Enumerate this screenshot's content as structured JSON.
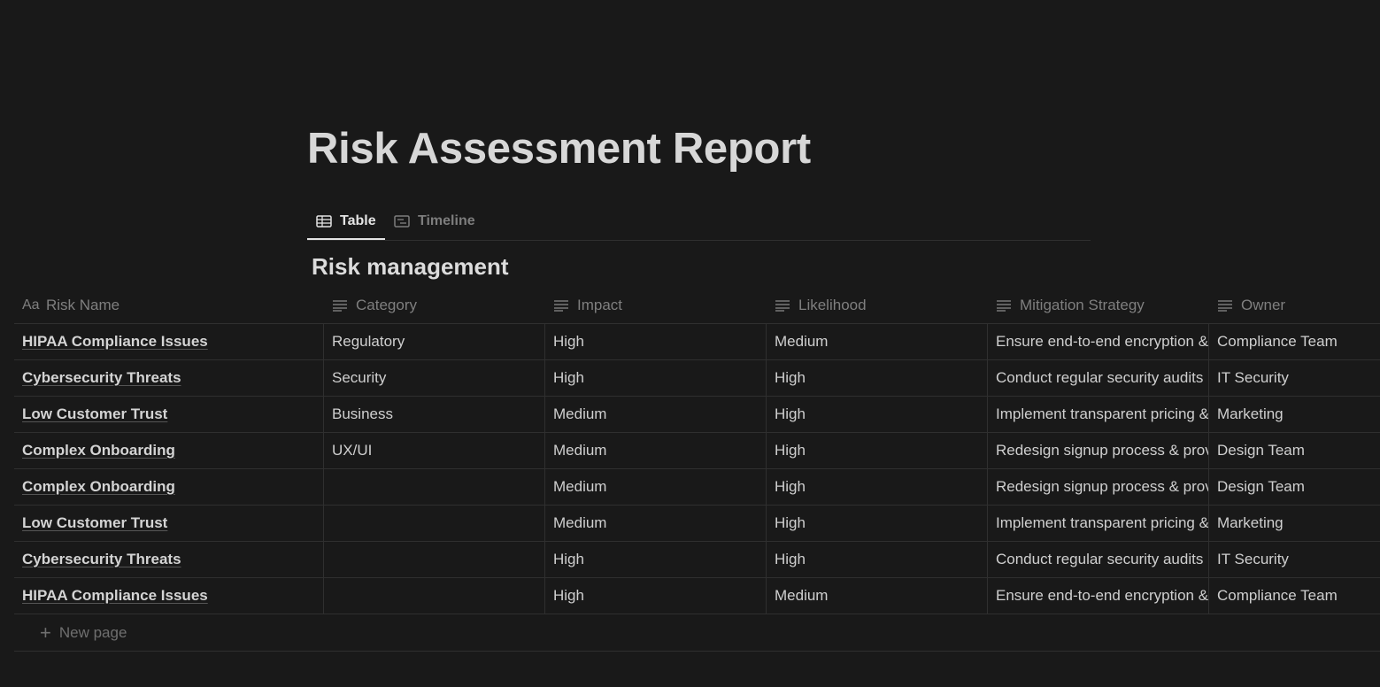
{
  "page": {
    "title": "Risk Assessment Report"
  },
  "tabs": [
    {
      "label": "Table",
      "icon": "table-icon",
      "active": true
    },
    {
      "label": "Timeline",
      "icon": "timeline-icon",
      "active": false
    }
  ],
  "database": {
    "title": "Risk management",
    "columns": [
      {
        "label": "Risk Name",
        "icon": "title-property-icon"
      },
      {
        "label": "Category",
        "icon": "text-property-icon"
      },
      {
        "label": "Impact",
        "icon": "text-property-icon"
      },
      {
        "label": "Likelihood",
        "icon": "text-property-icon"
      },
      {
        "label": "Mitigation Strategy",
        "icon": "text-property-icon"
      },
      {
        "label": "Owner",
        "icon": "text-property-icon"
      }
    ],
    "rows": [
      [
        "HIPAA Compliance Issues",
        "Regulatory",
        "High",
        "Medium",
        "Ensure end-to-end encryption &",
        "Compliance Team"
      ],
      [
        "Cybersecurity Threats",
        "Security",
        "High",
        "High",
        "Conduct regular security audits",
        "IT Security"
      ],
      [
        "Low Customer Trust",
        "Business",
        "Medium",
        "High",
        "Implement transparent pricing &",
        "Marketing"
      ],
      [
        "Complex Onboarding",
        "UX/UI",
        "Medium",
        "High",
        "Redesign signup process & prov",
        "Design Team"
      ],
      [
        "Complex Onboarding",
        "",
        "Medium",
        "High",
        "Redesign signup process & prov",
        "Design Team"
      ],
      [
        "Low Customer Trust",
        "",
        "Medium",
        "High",
        "Implement transparent pricing &",
        "Marketing"
      ],
      [
        "Cybersecurity Threats",
        "",
        "High",
        "High",
        "Conduct regular security audits",
        "IT Security"
      ],
      [
        "HIPAA Compliance Issues",
        "",
        "High",
        "Medium",
        "Ensure end-to-end encryption &",
        "Compliance Team"
      ]
    ],
    "new_page_label": "New page"
  }
}
